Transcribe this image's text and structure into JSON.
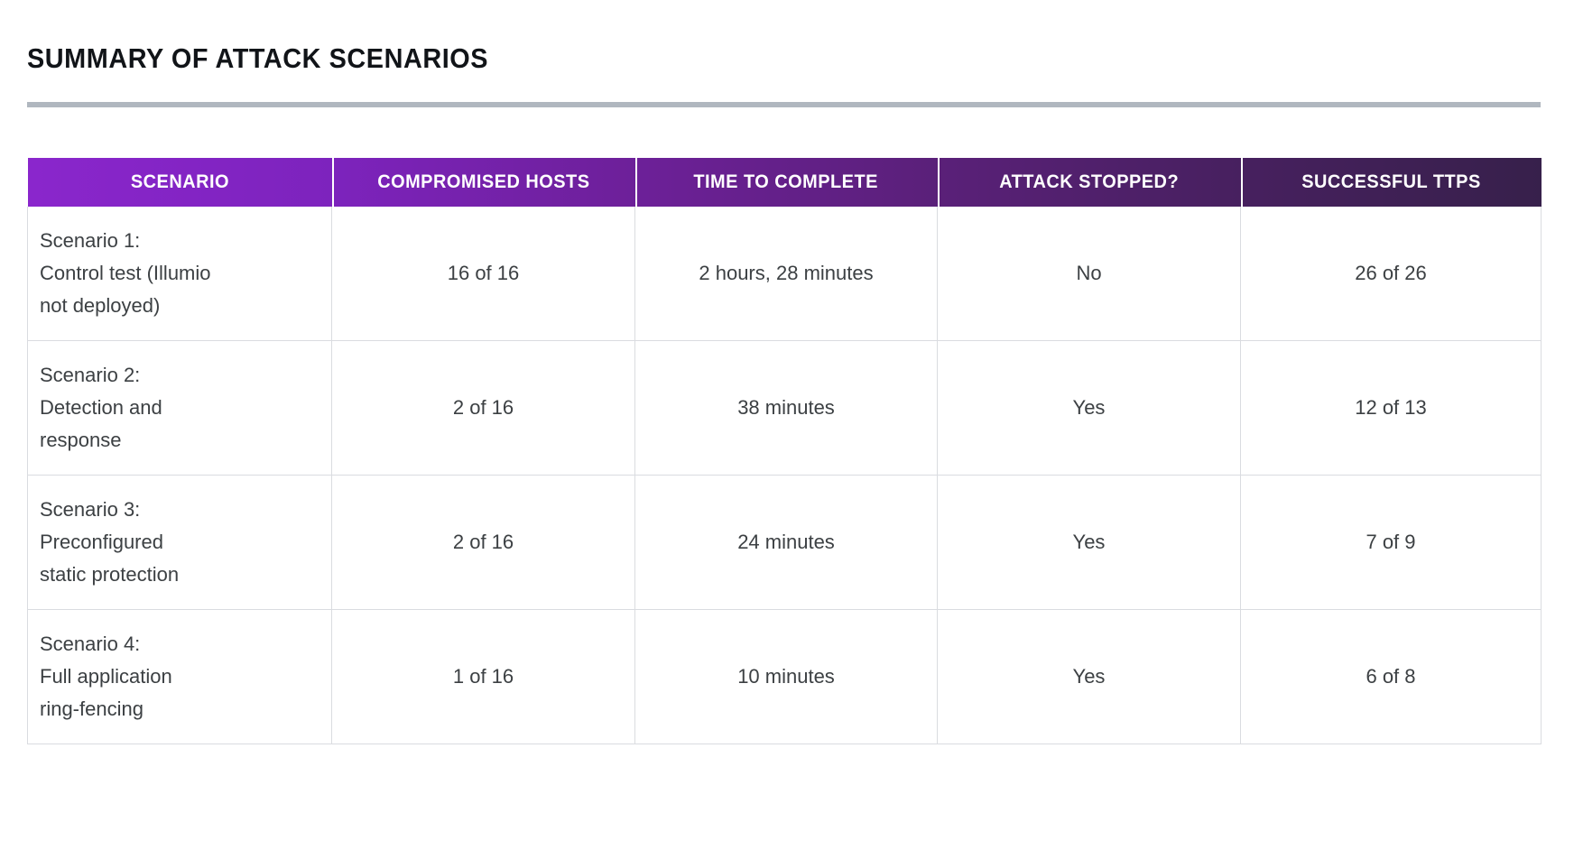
{
  "page": {
    "title": "SUMMARY OF ATTACK SCENARIOS",
    "divider_color": "#b0b7bf",
    "background": "#ffffff",
    "text_color": "#3c4043"
  },
  "table": {
    "header_gradient_start": "#8a26cc",
    "header_gradient_end": "#37204b",
    "header_text_color": "#ffffff",
    "grid_line_color": "#dadce0",
    "columns": [
      "SCENARIO",
      "COMPROMISED HOSTS",
      "TIME TO COMPLETE",
      "ATTACK STOPPED?",
      "SUCCESSFUL TTPs"
    ],
    "rows": [
      {
        "scenario_lines": [
          "Scenario 1:",
          "Control test (Illumio",
          "not deployed)"
        ],
        "compromised_hosts": "16 of 16",
        "time_to_complete": "2 hours, 28 minutes",
        "attack_stopped": "No",
        "successful_ttps": "26 of 26"
      },
      {
        "scenario_lines": [
          "Scenario 2:",
          "Detection and",
          "response"
        ],
        "compromised_hosts": "2 of 16",
        "time_to_complete": "38 minutes",
        "attack_stopped": "Yes",
        "successful_ttps": "12 of 13"
      },
      {
        "scenario_lines": [
          "Scenario 3:",
          "Preconfigured",
          "static protection"
        ],
        "compromised_hosts": "2 of 16",
        "time_to_complete": "24 minutes",
        "attack_stopped": "Yes",
        "successful_ttps": "7 of 9"
      },
      {
        "scenario_lines": [
          "Scenario 4:",
          "Full application",
          "ring-fencing"
        ],
        "compromised_hosts": "1 of 16",
        "time_to_complete": "10 minutes",
        "attack_stopped": "Yes",
        "successful_ttps": "6 of 8"
      }
    ]
  }
}
